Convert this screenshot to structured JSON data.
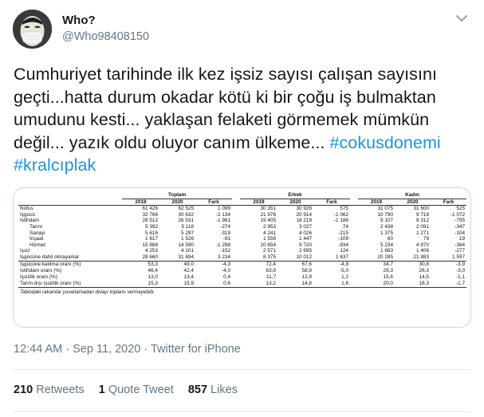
{
  "header": {
    "display_name": "Who?",
    "handle": "@Who98408150",
    "avatar_icon": "masked-face-avatar",
    "menu_icon": "chevron-down-icon"
  },
  "tweet": {
    "text": "Cumhuriyet tarihinde ilk kez işsiz sayısı çalışan sayısını geçti...hatta durum okadar kötü ki bir çoğu iş bulmaktan umudunu kesti... yaklaşan felaketi görmemek mümkün değil... yazık oldu oluyor canım ülkeme... ",
    "hashtags": [
      "#cokusdonemi",
      "#kralcıplak"
    ],
    "hashtag_color": "#1b95e0"
  },
  "table": {
    "groups": [
      "Toplam",
      "Erkek",
      "Kadın"
    ],
    "year_cols": [
      "2019",
      "2020",
      "Fark"
    ],
    "rows": [
      {
        "label": "Nüfus",
        "indent": false,
        "values": [
          "61 426",
          "62 525",
          "1 099",
          "30 351",
          "30 926",
          "575",
          "31 075",
          "31 600",
          "525"
        ]
      },
      {
        "label": "İşgücü",
        "indent": false,
        "values": [
          "32 766",
          "30 632",
          "-2 134",
          "21 976",
          "20 914",
          "-1 062",
          "10 790",
          "9 718",
          "-1 072"
        ]
      },
      {
        "label": "İstihdam",
        "indent": false,
        "values": [
          "28 512",
          "26 531",
          "-1 981",
          "19 405",
          "18 219",
          "-1 186",
          "9 107",
          "8 312",
          "-795"
        ]
      },
      {
        "label": "Tarım",
        "indent": true,
        "values": [
          "5 392",
          "5 118",
          "-274",
          "2 953",
          "3 027",
          "74",
          "2 438",
          "2 091",
          "-347"
        ]
      },
      {
        "label": "Sanayi",
        "indent": true,
        "values": [
          "5 616",
          "5 297",
          "-319",
          "4 241",
          "4 026",
          "-215",
          "1 375",
          "1 271",
          "-104"
        ]
      },
      {
        "label": "İnşaat",
        "indent": true,
        "values": [
          "1 617",
          "1 526",
          "-91",
          "1 556",
          "1 447",
          "-109",
          "60",
          "79",
          "19"
        ]
      },
      {
        "label": "Hizmet",
        "indent": true,
        "values": [
          "15 888",
          "14 590",
          "-1 298",
          "10 654",
          "9 720",
          "-934",
          "5 234",
          "4 870",
          "-364"
        ]
      },
      {
        "label": "İşsiz",
        "indent": false,
        "values": [
          "4 253",
          "4 101",
          "-152",
          "2 571",
          "2 695",
          "124",
          "1 683",
          "1 406",
          "-277"
        ]
      },
      {
        "label": "İşgücüne dahil olmayanlar",
        "indent": false,
        "values": [
          "28 660",
          "31 894",
          "3 234",
          "8 375",
          "10 012",
          "1 637",
          "20 285",
          "21 883",
          "1 597"
        ]
      }
    ],
    "pct_rows": [
      {
        "label": "İşgücüne katılma oranı (%)",
        "values": [
          "53,3",
          "49,0",
          "-4,3",
          "72,4",
          "67,6",
          "-4,8",
          "34,7",
          "30,8",
          "-3,9"
        ]
      },
      {
        "label": "İstihdam oranı (%)",
        "values": [
          "46,4",
          "42,4",
          "-4,0",
          "63,9",
          "58,9",
          "-5,0",
          "29,3",
          "26,3",
          "-3,0"
        ]
      },
      {
        "label": "İşsizlik oranı (%)",
        "values": [
          "13,0",
          "13,4",
          "0,4",
          "11,7",
          "12,9",
          "1,2",
          "15,6",
          "14,5",
          "-1,1"
        ]
      },
      {
        "label": "Tarım dışı işsizlik oranı (%)",
        "values": [
          "15,3",
          "15,9",
          "0,6",
          "13,2",
          "14,8",
          "1,6",
          "20,0",
          "18,3",
          "-1,7"
        ]
      }
    ],
    "note": "Tablodaki rakamlar yuvarlamadan dolayı toplamı vermeyebilir."
  },
  "meta": {
    "time": "12:44 AM",
    "separator": " · ",
    "date": "Sep 11, 2020",
    "source": "Twitter for iPhone"
  },
  "stats": {
    "retweets_count": "210",
    "retweets_label": "Retweets",
    "quote_count": "1",
    "quote_label": "Quote Tweet",
    "likes_count": "857",
    "likes_label": "Likes"
  }
}
